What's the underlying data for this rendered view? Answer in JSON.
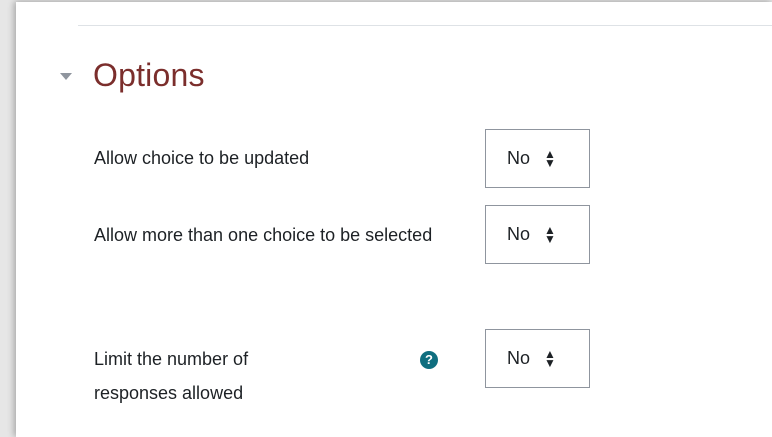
{
  "section": {
    "title": "Options"
  },
  "settings": [
    {
      "label": "Allow choice to be updated",
      "value": "No"
    },
    {
      "label": "Allow more than one choice to be selected",
      "value": "No"
    },
    {
      "label": "Limit the number of responses allowed",
      "value": "No",
      "help_icon": "question-circle-icon"
    }
  ],
  "colors": {
    "title": "#7b2e2c",
    "help_icon": "#0f6e7f",
    "select_border": "#8f959e"
  }
}
